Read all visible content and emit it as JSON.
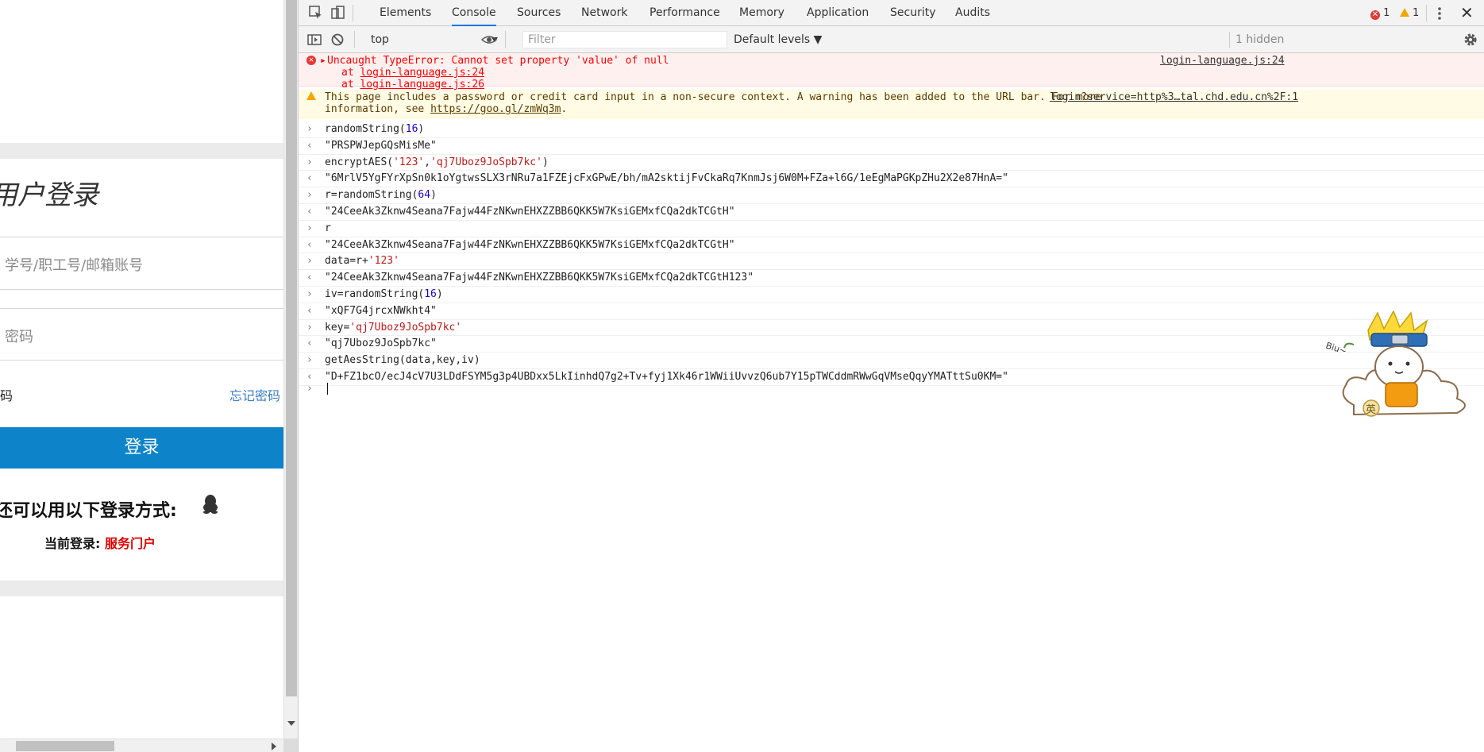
{
  "page": {
    "title": "用户登录",
    "username_placeholder": "学号/职工号/邮箱账号",
    "password_placeholder": "密码",
    "remember_label": "码",
    "forgot_password": "忘记密码",
    "login_button": "登录",
    "other_methods": "还可以用以下登录方式:",
    "current_login_label": "当前登录:",
    "current_login_value": "服务门户"
  },
  "devtools": {
    "tabs": [
      "Elements",
      "Console",
      "Sources",
      "Network",
      "Performance",
      "Memory",
      "Application",
      "Security",
      "Audits"
    ],
    "active_tab": "Console",
    "error_count": "1",
    "warning_count": "1",
    "context": "top",
    "filter_placeholder": "Filter",
    "levels": "Default levels ▼",
    "hidden": "1 hidden"
  },
  "console": {
    "error": {
      "message": "Uncaught TypeError: Cannot set property 'value' of null",
      "trace1_prefix": "at ",
      "trace1_link": "login-language.js:24",
      "trace2_prefix": "at ",
      "trace2_link": "login-language.js:26",
      "source": "login-language.js:24"
    },
    "warning": {
      "line1": "This page includes a password or credit card input in a non-secure context. A warning has been added to the URL bar. For more",
      "line2_prefix": "information, see ",
      "line2_link": "https://goo.gl/zmWq3m",
      "line2_suffix": ".",
      "source": "login?service=http%3…tal.chd.edu.cn%2F:1"
    },
    "entries": [
      {
        "kind": "in",
        "text": "randomString(16)"
      },
      {
        "kind": "out",
        "text": "\"PRSPWJepGQsMisMe\""
      },
      {
        "kind": "in",
        "text": "encryptAES('123','qj7Uboz9JoSpb7kc')"
      },
      {
        "kind": "out",
        "text": "\"6MrlV5YgFYrXpSn0k1oYgtwsSLX3rNRu7a1FZEjcFxGPwE/bh/mA2sktijFvCkaRq7KnmJsj6W0M+FZa+l6G/1eEgMaPGKpZHu2X2e87HnA=\""
      },
      {
        "kind": "in",
        "text": "r=randomString(64)"
      },
      {
        "kind": "out",
        "text": "\"24CeeAk3Zknw4Seana7Fajw44FzNKwnEHXZZBB6QKK5W7KsiGEMxfCQa2dkTCGtH\""
      },
      {
        "kind": "in",
        "text": "r"
      },
      {
        "kind": "out",
        "text": "\"24CeeAk3Zknw4Seana7Fajw44FzNKwnEHXZZBB6QKK5W7KsiGEMxfCQa2dkTCGtH\""
      },
      {
        "kind": "in",
        "text": "data=r+'123'"
      },
      {
        "kind": "out",
        "text": "\"24CeeAk3Zknw4Seana7Fajw44FzNKwnEHXZZBB6QKK5W7KsiGEMxfCQa2dkTCGtH123\""
      },
      {
        "kind": "in",
        "text": "iv=randomString(16)"
      },
      {
        "kind": "out",
        "text": "\"xQF7G4jrcxNWkht4\""
      },
      {
        "kind": "in",
        "text": "key='qj7Uboz9JoSpb7kc'"
      },
      {
        "kind": "out",
        "text": "\"qj7Uboz9JoSpb7kc\""
      },
      {
        "kind": "in",
        "text": "getAesString(data,key,iv)"
      },
      {
        "kind": "out",
        "text": "\"D+FZ1bcO/ecJ4cV7U3LDdFSYM5g3p4UBDxx5LkIinhdQ7g2+Tv+fyj1Xk46r1WWiiUvvzQ6ub7Y15pTWCddmRWwGqVMseQqyYMATttSu0KM=\""
      }
    ],
    "sticker_text": "Biu~",
    "sticker_badge": "英"
  }
}
